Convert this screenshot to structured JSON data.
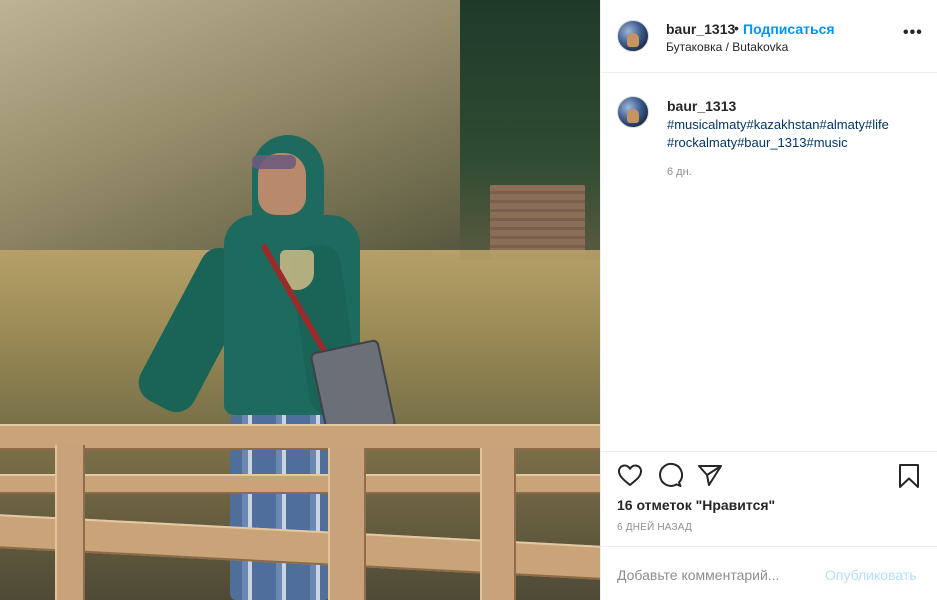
{
  "photo": {
    "description_icon": "post-photo"
  },
  "header": {
    "username": "baur_1313",
    "dot": "•",
    "follow_label": "Подписаться",
    "location": "Бутаковка / Butakovka",
    "more_icon": "ellipsis-icon",
    "more_text": "•••"
  },
  "caption": {
    "username": "baur_1313",
    "hashtags_line1": "#musicalmaty#kazakhstan#almaty#life",
    "hashtags_line2": "#rockalmaty#baur_1313#music",
    "time": "6 дн."
  },
  "actions": {
    "likes": "16 отметок \"Нравится\"",
    "posted": "6 ДНЕЙ НАЗАД",
    "comment_placeholder": "Добавьте комментарий...",
    "publish_label": "Опубликовать"
  },
  "colors": {
    "accent": "#0095f6",
    "hashtag": "#00376b",
    "muted": "#8e8e8e",
    "publish_disabled": "#b2dffc"
  }
}
